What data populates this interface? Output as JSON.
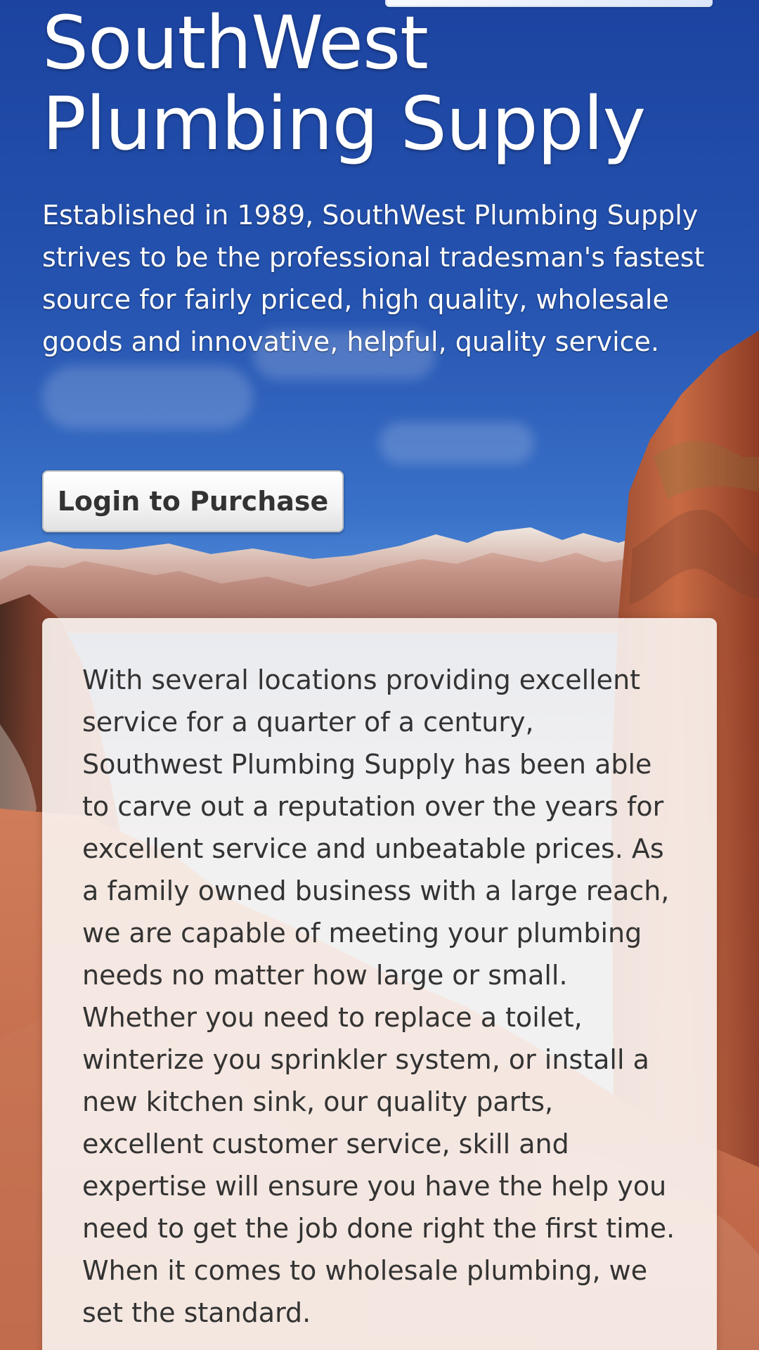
{
  "page": {
    "hero_title_line_1": "SouthWest",
    "hero_title_line_2": "Plumbing Supply",
    "intro_text": "Established in 1989, SouthWest Plumbing Supply strives to be the professional tradesman's fastest source for fairly priced, high quality, wholesale goods and innovative, helpful, quality service.",
    "login_button_label": "Login to Purchase",
    "about_text": "With several locations providing excellent service for a quarter of a century, Southwest Plumbing Supply has been able to carve out a reputation over the years for excellent service and unbeatable prices. As a family owned business with a large reach, we are capable of meeting your plumbing needs no matter how large or small. Whether you need to replace a toilet, winterize you sprinkler system, or install a new kitchen sink, our quality parts, excellent customer service, skill and expertise will ensure you have the help you need to get the job done right the first time. When it comes to wholesale plumbing, we set the standard."
  },
  "colors": {
    "sky_top": "#1c43a0",
    "sky_bottom": "#b0d3f5",
    "canyon_red": "#b85a3a",
    "panel_background": "#faf4f1",
    "button_text": "#333333",
    "body_text": "#333333",
    "hero_text": "#ffffff"
  }
}
